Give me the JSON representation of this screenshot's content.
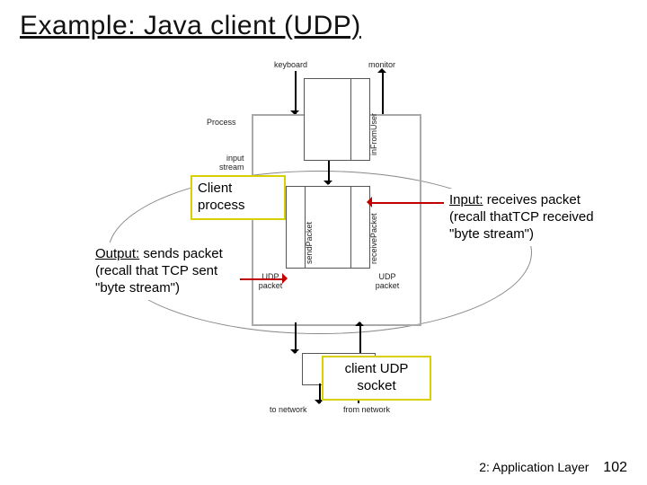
{
  "title": "Example: Java client (UDP)",
  "diagram": {
    "keyboard": "keyboard",
    "monitor": "monitor",
    "process": "Process",
    "input_stream": "input\nstream",
    "in_from_user": "inFromUser",
    "send_packet": "sendPacket",
    "receive_packet": "receivePacket",
    "udp_packet_left": "UDP\npacket",
    "udp_packet_right": "UDP\npacket",
    "udp_socket": "UDP\nsocket",
    "to_network": "to network",
    "from_network": "from network"
  },
  "callouts": {
    "client_process": "Client process",
    "output": "<span class='u'>Output:</span> sends packet (recall that TCP sent \"byte stream\")",
    "input": "<span class='u'>Input:</span> receives packet (recall thatTCP received \"byte stream\")",
    "client_udp_socket": "client UDP socket"
  },
  "footer": {
    "section": "2: Application Layer",
    "page": "102"
  }
}
